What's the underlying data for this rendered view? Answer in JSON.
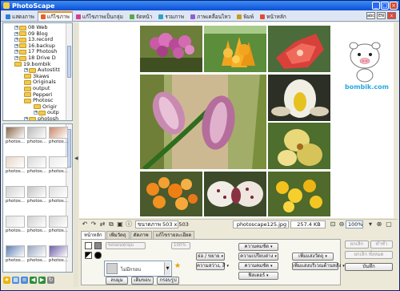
{
  "window": {
    "title": "PhotoScape"
  },
  "tabs": [
    {
      "label": "แสดงภาพ",
      "color": "#2e7fd8"
    },
    {
      "label": "แก้ไขภาพ",
      "color": "#e85f2a"
    },
    {
      "label": "แก้ไขภาพเป็นกลุ่ม",
      "color": "#d83c8c"
    },
    {
      "label": "จัดหน้า",
      "color": "#5aa84c"
    },
    {
      "label": "รวมภาพ",
      "color": "#2fa2c8"
    },
    {
      "label": "ภาพเคลื่อนไหว",
      "color": "#8e5ed8"
    },
    {
      "label": "พิมพ์",
      "color": "#c89a22"
    },
    {
      "label": "หน้าหลัก",
      "color": "#e04a3a"
    }
  ],
  "active_tab": 1,
  "top_right_buttons": [
    "abc",
    "EN",
    "x"
  ],
  "tree": {
    "items": [
      "08 Web",
      "09 Blog",
      "13.record",
      "16.backup",
      "17 Photosh",
      "18 Drive D",
      "19.bombik",
      "Autostitt",
      "3kaws",
      "Originals",
      "output",
      "Pepperi",
      "Photosc",
      "Origir",
      "outp",
      "photosh"
    ]
  },
  "thumbnails": [
    "photos...",
    "photos...",
    "photos...",
    "photos...",
    "photos...",
    "photos...",
    "photos...",
    "photos...",
    "photos...",
    "photos...",
    "photos...",
    "photos...",
    "photos...",
    "photos...",
    "photos..."
  ],
  "status": {
    "size_label": "ขนาดภาพ 503 x 503",
    "filename": "photoscape125.jpg",
    "filesize": "257.4 KB",
    "zoom": "100%"
  },
  "logo_text": "bombik.com",
  "edit_tabs": [
    "หน้าหลัก",
    "เพิ่มวัตถุ",
    "ตัดภาพ",
    "แก้ไขรายละเอียด"
  ],
  "edit_panel": {
    "round_label": "ขอบมนทุกมุม",
    "round_value": "100%",
    "frame_label": "ไม่มีกรอบ",
    "buttons_bottom": [
      "ลบมุม",
      "เติมขอบ",
      "กรอบรูป"
    ],
    "col1": [
      "ย่อ / ขยาย",
      "ความสว่าง, สี"
    ],
    "col2": [
      "ความคมชัด",
      "ความเปรียบต่าง",
      "ความคมชัด"
    ],
    "col3": [
      "เพิ่มแสงวัตถุ",
      "เพิ่มแสงบริเวณด้านหลัง"
    ],
    "filter": "ฟิลเตอร์"
  },
  "right_buttons": {
    "undo": "ยกเลิก",
    "redo": "ทำซ้ำ",
    "undo_all": "ยกเลิก ทั้งหมด",
    "save": "บันทึก"
  }
}
